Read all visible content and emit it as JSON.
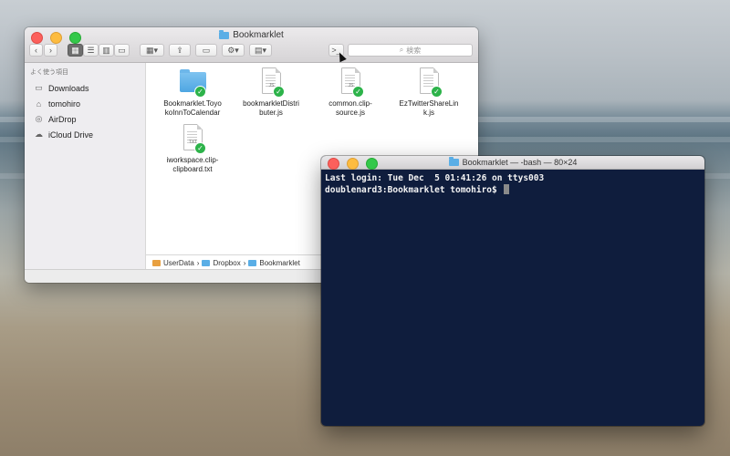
{
  "finder": {
    "title": "Bookmarklet",
    "search_placeholder": "検索",
    "toolbar": {
      "back": "‹",
      "forward": "›",
      "share": "⇪",
      "action": "⚙▾",
      "terminal": ">_"
    },
    "sidebar": {
      "heading": "よく使う項目",
      "items": [
        {
          "label": "Downloads",
          "icon": "downloads-folder-icon"
        },
        {
          "label": "tomohiro",
          "icon": "home-icon"
        },
        {
          "label": "AirDrop",
          "icon": "airdrop-icon"
        },
        {
          "label": "iCloud Drive",
          "icon": "cloud-icon"
        }
      ]
    },
    "files": [
      {
        "name": "Bookmarklet.ToyokoInnToCalendar",
        "line1": "Bookmarklet.Toyo",
        "line2": "koInnToCalendar",
        "kind": "folder",
        "tag": ""
      },
      {
        "name": "bookmarkletDistributer.js",
        "line1": "bookmarkletDistri",
        "line2": "buter.js",
        "kind": "doc",
        "tag": "JS"
      },
      {
        "name": "common.clip-source.js",
        "line1": "common.clip-",
        "line2": "source.js",
        "kind": "doc",
        "tag": "JS"
      },
      {
        "name": "EzTwitterShareLink.js",
        "line1": "EzTwitterShareLin",
        "line2": "k.js",
        "kind": "doc",
        "tag": ""
      },
      {
        "name": "iworkspace.clip-clipboard.txt",
        "line1": "iworkspace.clip-",
        "line2": "clipboard.txt",
        "kind": "doc",
        "tag": "TXT"
      }
    ],
    "path": [
      "UserData",
      "Dropbox",
      "Bookmarklet"
    ],
    "path_sep": "›"
  },
  "terminal": {
    "title": "Bookmarklet — -bash — 80×24",
    "lines": [
      "Last login: Tue Dec  5 01:41:26 on ttys003",
      "doublenard3:Bookmarklet tomohiro$ "
    ]
  },
  "colors": {
    "terminal_bg": "#0f1d3d",
    "folder_blue": "#4ea6e2",
    "check_green": "#2db34a"
  }
}
